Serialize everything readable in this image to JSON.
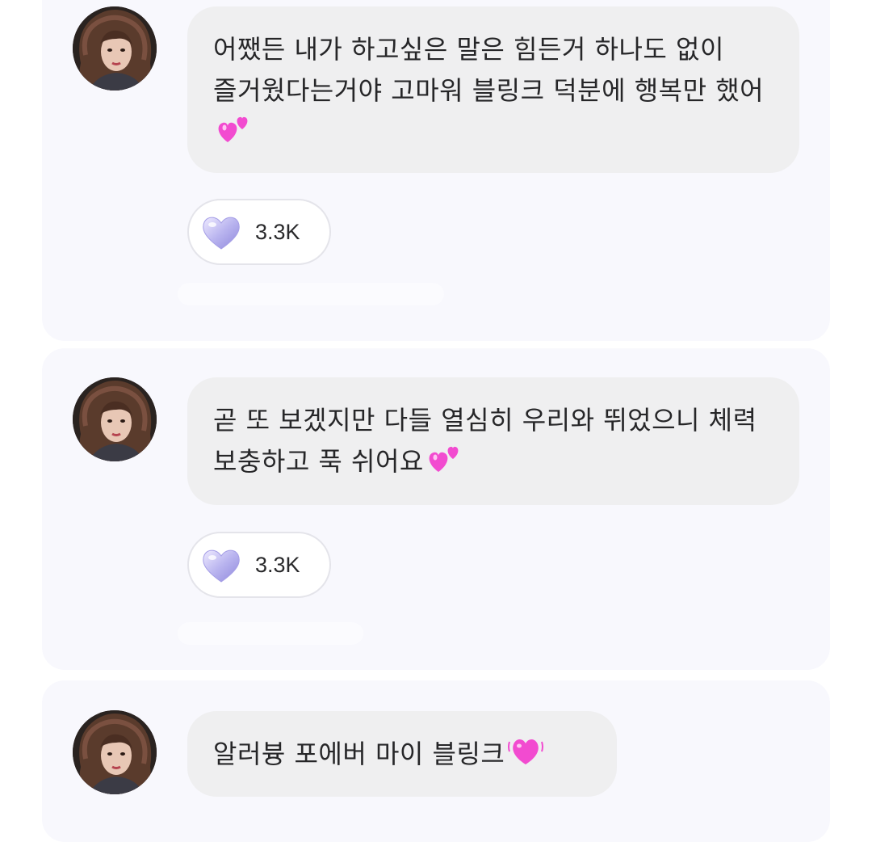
{
  "messages": [
    {
      "text": "어쨌든 내가 하고싶은 말은 힘든거 하나도 없이 즐거웠다는거야 고마워 블링크 덕분에 행복만 했어",
      "emoji": "two-hearts-icon",
      "reaction": {
        "icon": "crystal-heart-icon",
        "count": "3.3K"
      }
    },
    {
      "text": "곧 또 보겠지만 다들 열심히 우리와 뛰었으니 체력 보충하고 푹 쉬어요",
      "emoji": "two-hearts-icon",
      "reaction": {
        "icon": "crystal-heart-icon",
        "count": "3.3K"
      }
    },
    {
      "text": "알러븅 포에버 마이 블링크",
      "emoji": "beating-heart-icon"
    }
  ],
  "colors": {
    "card_background": "#f8f8fd",
    "bubble_background": "#efeff0",
    "text": "#262628",
    "heart_pink": "#f24bd0",
    "reaction_heart": "#b9b4ef"
  }
}
